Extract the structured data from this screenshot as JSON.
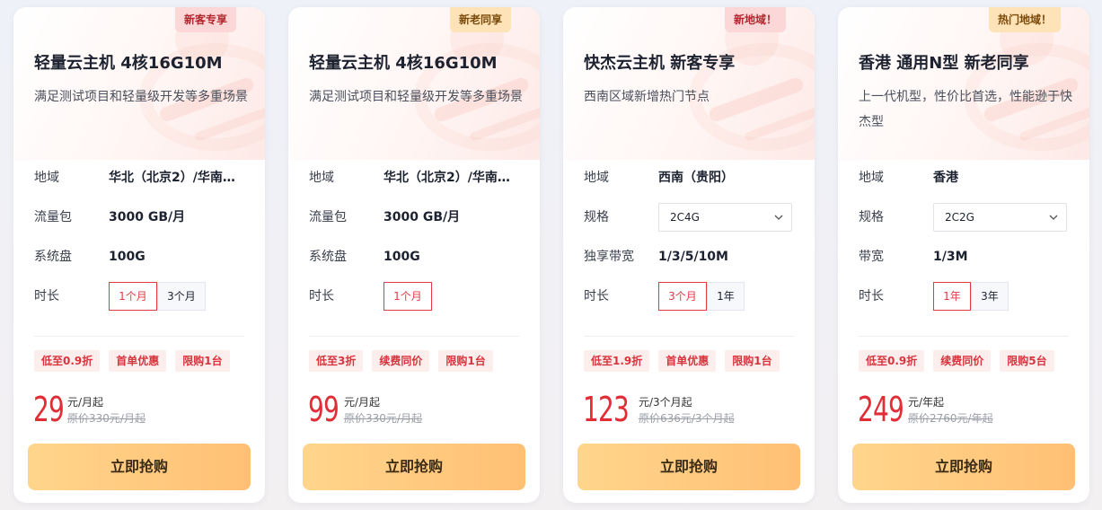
{
  "cards": [
    {
      "badge": "新客专享",
      "badge_color": "#fbd7d7",
      "title": "轻量云主机 4核16G10M",
      "desc": "满足测试项目和轻量级开发等多重场景",
      "rows": [
        {
          "label": "地域",
          "value": "华北（北京2）/华南…"
        },
        {
          "label": "流量包",
          "value": "3000 GB/月"
        },
        {
          "label": "系统盘",
          "value": "100G"
        },
        {
          "label": "时长",
          "options": [
            "1个月",
            "3个月"
          ],
          "selected": "1个月"
        }
      ],
      "tags": [
        "低至0.9折",
        "首单优惠",
        "限购1台"
      ],
      "price": "29",
      "unit": "元/月起",
      "original": "原价330元/月起",
      "button": "立即抢购"
    },
    {
      "badge": "新老同享",
      "badge_color": "#fde3b7",
      "title": "轻量云主机 4核16G10M",
      "desc": "满足测试项目和轻量级开发等多重场景",
      "rows": [
        {
          "label": "地域",
          "value": "华北（北京2）/华南…"
        },
        {
          "label": "流量包",
          "value": "3000 GB/月"
        },
        {
          "label": "系统盘",
          "value": "100G"
        },
        {
          "label": "时长",
          "options": [
            "1个月"
          ],
          "selected": "1个月"
        }
      ],
      "tags": [
        "低至3折",
        "续费同价",
        "限购1台"
      ],
      "price": "99",
      "unit": "元/月起",
      "original": "原价330元/月起",
      "button": "立即抢购"
    },
    {
      "badge": "新地域！",
      "badge_color": "#fbd7d7",
      "title": "快杰云主机 新客专享",
      "desc": "西南区域新增热门节点",
      "rows": [
        {
          "label": "地域",
          "value": "西南（贵阳）"
        },
        {
          "label": "规格",
          "select": "2C4G"
        },
        {
          "label": "独享带宽",
          "value": "1/3/5/10M"
        },
        {
          "label": "时长",
          "options": [
            "3个月",
            "1年"
          ],
          "selected": "3个月"
        }
      ],
      "tags": [
        "低至1.9折",
        "首单优惠",
        "限购1台"
      ],
      "price": "123",
      "unit": "元/3个月起",
      "original": "原价636元/3个月起",
      "button": "立即抢购"
    },
    {
      "badge": "热门地域！",
      "badge_color": "#fde3b7",
      "title": "香港 通用N型 新老同享",
      "desc": "上一代机型，性价比首选，性能逊于快杰型",
      "rows": [
        {
          "label": "地域",
          "value": "香港"
        },
        {
          "label": "规格",
          "select": "2C2G"
        },
        {
          "label": "带宽",
          "value": "1/3M"
        },
        {
          "label": "时长",
          "options": [
            "1年",
            "3年"
          ],
          "selected": "1年"
        }
      ],
      "tags": [
        "低至0.9折",
        "续费同价",
        "限购5台"
      ],
      "price": "249",
      "unit": "元/年起",
      "original": "原价2760元/年起",
      "button": "立即抢购"
    }
  ],
  "colors": {
    "accent_red": "#e02d36",
    "button_gradient_start": "#ffd58c",
    "button_gradient_end": "#ffc074"
  }
}
